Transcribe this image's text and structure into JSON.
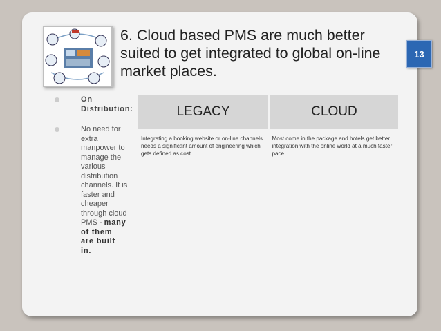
{
  "slide": {
    "number": "13",
    "title": "6. Cloud based PMS are much better suited to get integrated to global on-line market places."
  },
  "bullets": [
    {
      "label": "On Distribution:"
    },
    {
      "text": "No need for extra manpower to manage the various distribution channels. It is faster and cheaper through cloud PMS -",
      "bold": "many of them are built in."
    }
  ],
  "table": {
    "headers": [
      "LEGACY",
      "CLOUD"
    ],
    "cells": [
      "Integrating a booking website or on-line channels needs a significant amount of engineering which gets defined as cost.",
      "Most come in the package and hotels get better integration with the online world at a much faster pace."
    ]
  },
  "colors": {
    "slide_number_bg": "#2c67b3",
    "header_bg": "#d6d6d6",
    "slide_bg": "#f3f3f3"
  }
}
